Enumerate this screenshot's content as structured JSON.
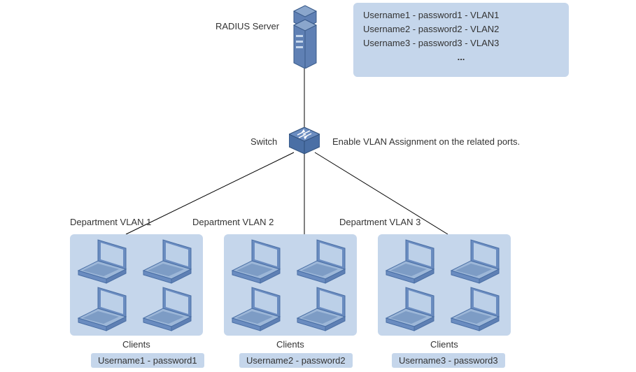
{
  "radius": {
    "label": "RADIUS Server",
    "entries": [
      "Username1 - password1 - VLAN1",
      "Username2 - password2 - VLAN2",
      "Username3 - password3 - VLAN3",
      "..."
    ]
  },
  "switch": {
    "label": "Switch",
    "note": "Enable VLAN Assignment on the related ports."
  },
  "departments": [
    {
      "label": "Department VLAN 1",
      "clients_label": "Clients",
      "cred": "Username1 - password1"
    },
    {
      "label": "Department VLAN 2",
      "clients_label": "Clients",
      "cred": "Username2 - password2"
    },
    {
      "label": "Department VLAN 3",
      "clients_label": "Clients",
      "cred": "Username3 - password3"
    }
  ]
}
